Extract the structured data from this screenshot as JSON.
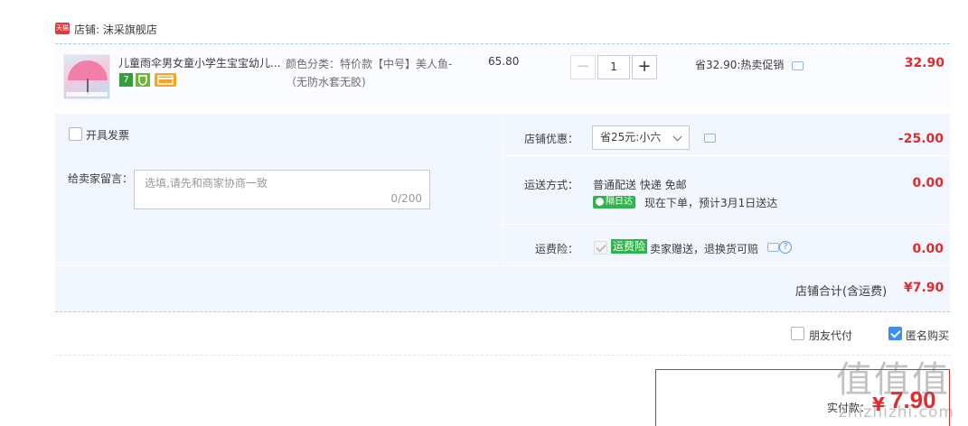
{
  "shop": {
    "badge": "天猫",
    "label": "店铺: 沫采旗舰店"
  },
  "item": {
    "title": "儿童雨伞男女童小学生宝宝幼儿...",
    "badges": [
      "7",
      "",
      ""
    ],
    "sku": "颜色分类：特价款【中号】美人鱼-（无防水套无胶)",
    "unit_price": "65.80",
    "quantity": "1",
    "qty_minus": "−",
    "qty_plus": "+",
    "promo": "省32.90:热卖促销",
    "total": "32.90"
  },
  "invoice": {
    "label": "开具发票"
  },
  "message": {
    "label": "给卖家留言：",
    "placeholder": "选填,请先和商家协商一致",
    "count": "0/200"
  },
  "coupon": {
    "label": "店铺优惠：",
    "selected": "省25元:小六",
    "amount": "-25.00"
  },
  "shipping": {
    "label": "运送方式：",
    "method": "普通配送 快递 免邮",
    "badge": "隔日达",
    "eta": "现在下单，预计3月1日送达",
    "amount": "0.00"
  },
  "insurance": {
    "label": "运费险：",
    "badge": "运费险",
    "desc": "卖家赠送，退换货可赔",
    "help": "?",
    "amount": "0.00"
  },
  "shop_total": {
    "label": "店铺合计(含运费)",
    "value": "¥7.90"
  },
  "options": {
    "friend_pay": "朋友代付",
    "anonymous": "匿名购买"
  },
  "payment": {
    "label": "实付款：",
    "currency": "¥",
    "value": "7.90"
  },
  "watermark": {
    "big": "值值值",
    "small": "zhizhizhi.com"
  }
}
